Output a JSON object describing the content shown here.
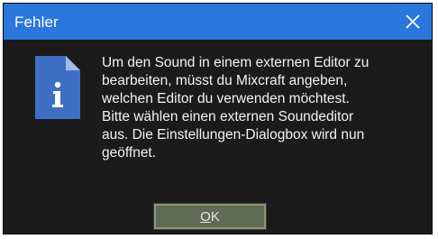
{
  "dialog": {
    "title": "Fehler",
    "icon": "info-document-icon",
    "close_icon": "close-icon",
    "message_lines": [
      "Um den Sound in einem externen Editor zu",
      "bearbeiten, müsst du Mixcraft angeben,",
      "welchen Editor du verwenden möchtest.",
      "Bitte wählen einen externen Soundeditor",
      "aus. Die Einstellungen-Dialogbox wird nun",
      "geöffnet."
    ],
    "ok_mnemonic": "O",
    "ok_rest": "K"
  },
  "colors": {
    "titlebar": "#2a77dc",
    "background": "#1b1b1b",
    "button": "#606a55",
    "icon": "#3e6fc4"
  }
}
